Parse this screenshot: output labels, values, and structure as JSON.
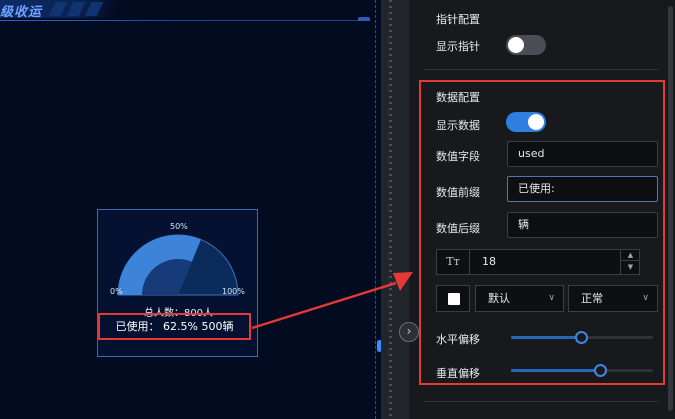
{
  "canvas": {
    "title": "级收运",
    "gauge": {
      "label_min": "0%",
      "label_mid": "50%",
      "label_max": "100%",
      "fill_fraction": 0.625,
      "total_text": "总人数：800人",
      "value_text": "已使用： 62.5% 500辆"
    }
  },
  "panel": {
    "pointer_section": {
      "title": "指针配置",
      "show_pointer_label": "显示指针",
      "show_pointer": false
    },
    "data_section": {
      "title": "数据配置",
      "show_data_label": "显示数据",
      "show_data": true,
      "field_label": "数值字段",
      "field_value": "used",
      "prefix_label": "数值前缀",
      "prefix_value": "已使用:",
      "suffix_label": "数值后缀",
      "suffix_value": "辆",
      "font_icon": "Tт",
      "font_size": "18",
      "color_value": "#ffffff",
      "font_family_select": "默认",
      "font_weight_select": "正常",
      "h_offset_label": "水平偏移",
      "h_offset_fraction": 0.49,
      "v_offset_label": "垂直偏移",
      "v_offset_fraction": 0.63
    }
  },
  "icons": {
    "collapse": "chevron-right-icon",
    "stepper_up": "caret-up-icon",
    "stepper_down": "caret-down-icon",
    "select_chevron": "chevron-down-icon"
  },
  "colors": {
    "accent": "#2f7fe0",
    "highlight": "#e53935",
    "gauge_fill": "#3d83d9"
  }
}
